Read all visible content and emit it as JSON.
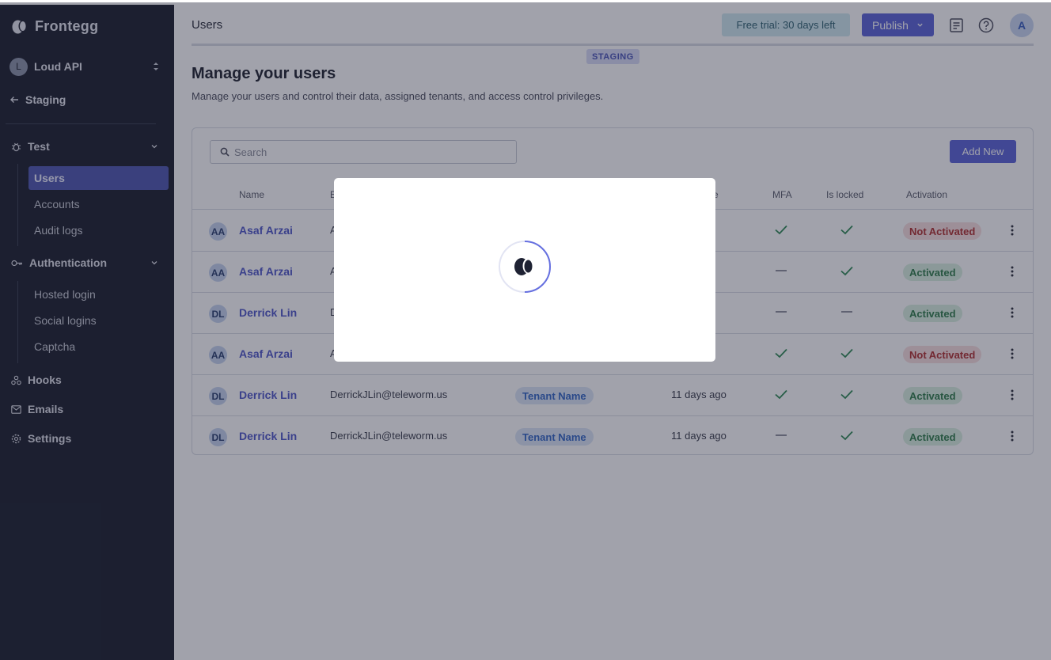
{
  "sidebar": {
    "brand": "Frontegg",
    "workspace": {
      "initial": "L",
      "name": "Loud API"
    },
    "back_label": "Staging",
    "sections": [
      {
        "label": "Test",
        "items": [
          "Users",
          "Accounts",
          "Audit logs"
        ],
        "active": "Users"
      },
      {
        "label": "Authentication",
        "items": [
          "Hosted login",
          "Social logins",
          "Captcha"
        ]
      }
    ],
    "links": [
      "Hooks",
      "Emails",
      "Settings"
    ]
  },
  "header": {
    "crumb": "Users",
    "trial_label": "Free trial: 30 days left",
    "publish_label": "Publish",
    "user_initial": "A",
    "env_badge": "STAGING"
  },
  "page": {
    "title": "Manage your users",
    "subtitle": "Manage your users and control their data, assigned tenants, and access control privileges."
  },
  "table": {
    "search_placeholder": "Search",
    "add_label": "Add New",
    "columns": {
      "name": "Name",
      "email": "E",
      "joined": "e",
      "mfa": "MFA",
      "locked": "Is locked",
      "activation": "Activation"
    },
    "rows": [
      {
        "initials": "AA",
        "name": "Asaf Arzai",
        "email": "A",
        "tenant": "",
        "joined": "go",
        "mfa": true,
        "locked": true,
        "status": "Not Activated"
      },
      {
        "initials": "AA",
        "name": "Asaf Arzai",
        "email": "A",
        "tenant": "",
        "joined": "go",
        "mfa": false,
        "locked": true,
        "status": "Activated"
      },
      {
        "initials": "DL",
        "name": "Derrick Lin",
        "email": "D",
        "tenant": "",
        "joined": "o",
        "mfa": false,
        "locked": false,
        "status": "Activated"
      },
      {
        "initials": "AA",
        "name": "Asaf Arzai",
        "email": "A",
        "tenant": "",
        "joined": "go",
        "mfa": true,
        "locked": true,
        "status": "Not Activated"
      },
      {
        "initials": "DL",
        "name": "Derrick Lin",
        "email": "DerrickJLin@teleworm.us",
        "tenant": "Tenant Name",
        "joined": "11 days ago",
        "mfa": true,
        "locked": true,
        "status": "Activated"
      },
      {
        "initials": "DL",
        "name": "Derrick Lin",
        "email": "DerrickJLin@teleworm.us",
        "tenant": "Tenant Name",
        "joined": "11 days ago",
        "mfa": false,
        "locked": true,
        "status": "Activated"
      }
    ]
  },
  "modal": {
    "icon": "frontegg-egg-loader-icon"
  },
  "colors": {
    "accent": "#5b63d8",
    "sidebar_bg": "#1b1e2c",
    "overlay": "rgba(30,34,55,0.42)"
  }
}
